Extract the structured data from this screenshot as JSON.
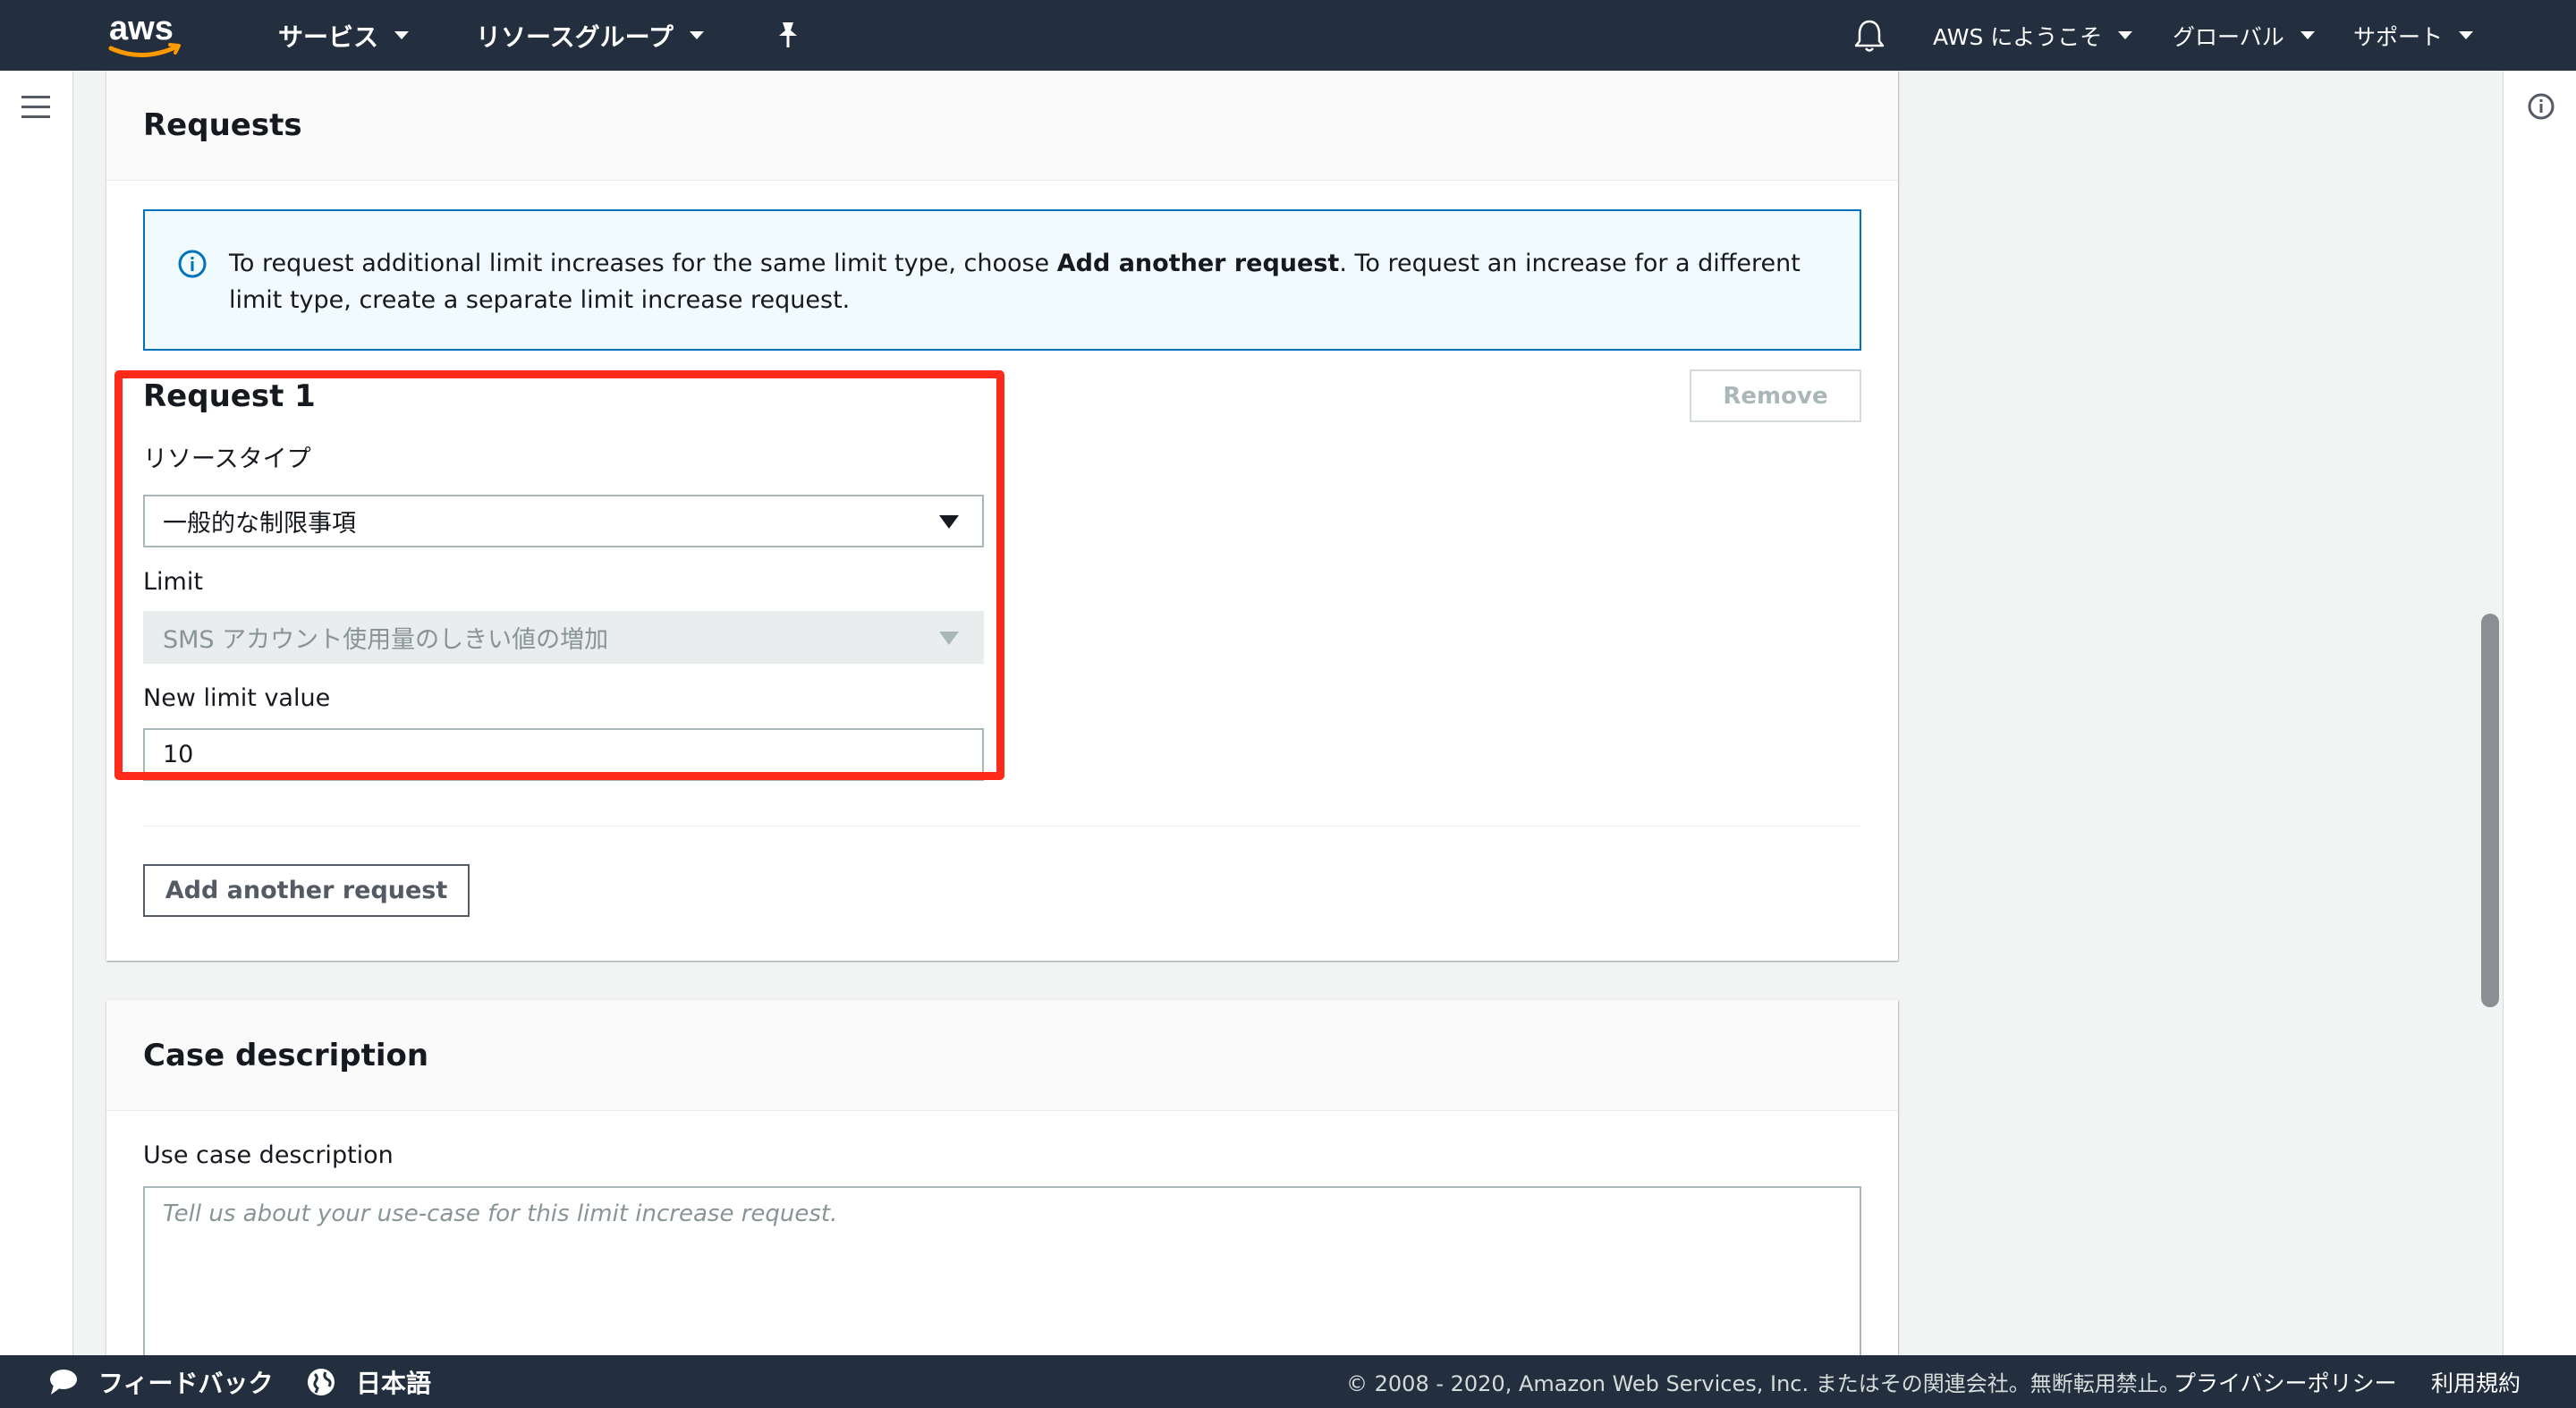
{
  "topnav": {
    "logo_text": "aws",
    "services": "サービス",
    "resource_groups": "リソースグループ",
    "account": "AWS にようこそ",
    "region": "グローバル",
    "support": "サポート"
  },
  "requests_panel": {
    "title": "Requests",
    "alert": {
      "text_before": "To request additional limit increases for the same limit type, choose ",
      "text_bold": "Add another request",
      "text_after": ". To request an increase for a different limit type, create a separate limit increase request."
    },
    "request": {
      "title": "Request 1",
      "remove_label": "Remove",
      "resource_type_label": "リソースタイプ",
      "resource_type_value": "一般的な制限事項",
      "limit_label": "Limit",
      "limit_value": "SMS アカウント使用量のしきい値の増加",
      "new_limit_label": "New limit value",
      "new_limit_value": "10"
    },
    "add_request_label": "Add another request"
  },
  "case_panel": {
    "title": "Case description",
    "use_case_label": "Use case description",
    "use_case_placeholder": "Tell us about your use-case for this limit increase request."
  },
  "footer": {
    "feedback": "フィードバック",
    "language": "日本語",
    "copyright": "© 2008 - 2020, Amazon Web Services, Inc. またはその関連会社。無断転用禁止。",
    "privacy": "プライバシーポリシー",
    "terms": "利用規約"
  },
  "colors": {
    "nav_bg": "#232f3e",
    "info_blue": "#0073bb",
    "highlight_red": "#ff2a1a",
    "aws_orange": "#ff9900"
  }
}
